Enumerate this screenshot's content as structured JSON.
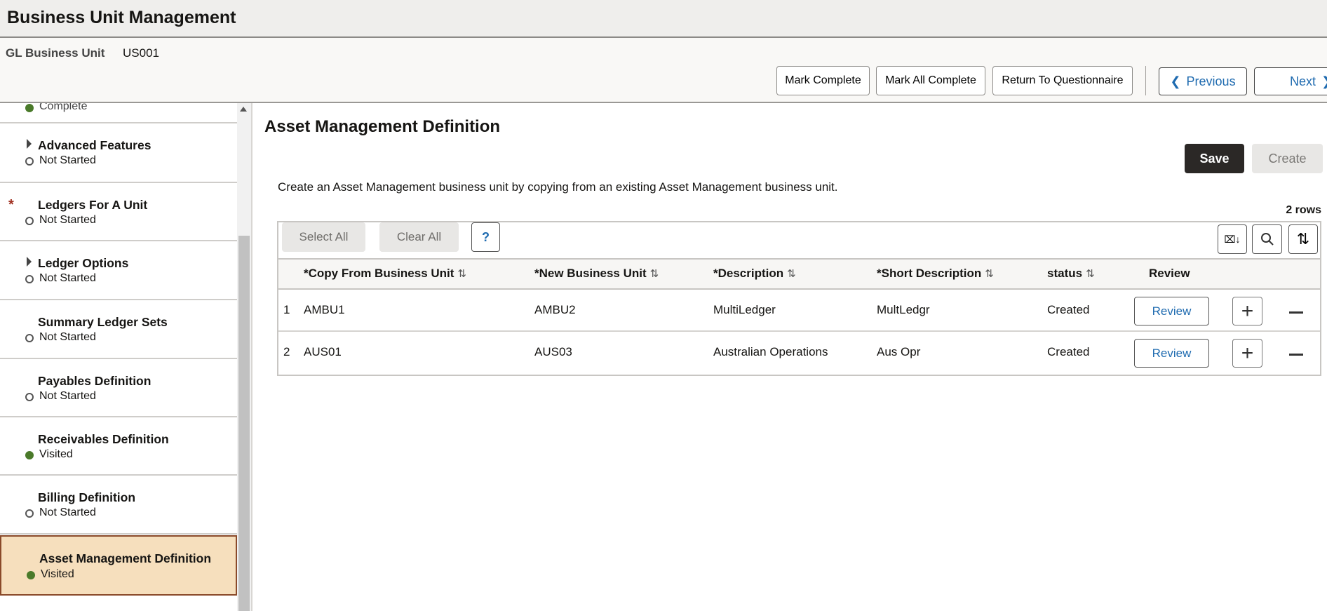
{
  "header": {
    "title": "Business Unit Management",
    "gl_label": "GL Business Unit",
    "gl_value": "US001"
  },
  "toolbar": {
    "mark_complete": "Mark Complete",
    "mark_all_complete": "Mark All Complete",
    "return": "Return To Questionnaire",
    "previous": "Previous",
    "next": "Next"
  },
  "sidebar": {
    "items": [
      {
        "title": "",
        "status": "Complete"
      },
      {
        "title": "Advanced Features",
        "status": "Not Started"
      },
      {
        "title": "Ledgers For A Unit",
        "status": "Not Started",
        "required": "*"
      },
      {
        "title": "Ledger Options",
        "status": "Not Started"
      },
      {
        "title": "Summary Ledger Sets",
        "status": "Not Started"
      },
      {
        "title": "Payables Definition",
        "status": "Not Started"
      },
      {
        "title": "Receivables Definition",
        "status": "Visited"
      },
      {
        "title": "Billing Definition",
        "status": "Not Started"
      },
      {
        "title": "Asset Management Definition",
        "status": "Visited"
      }
    ]
  },
  "main": {
    "heading": "Asset Management Definition",
    "save": "Save",
    "create": "Create",
    "description": "Create an Asset Management business unit by copying from an existing Asset Management business unit.",
    "row_count": "2 rows",
    "select_all": "Select All",
    "clear_all": "Clear All",
    "help": "?",
    "columns": [
      "*Copy From Business Unit",
      "*New Business Unit",
      "*Description",
      "*Short Description",
      "status",
      "Review"
    ],
    "sort_glyph": "⇅",
    "rows": [
      {
        "n": "1",
        "copy": "AMBU1",
        "new": "AMBU2",
        "desc": "MultiLedger",
        "short": "MultLedgr",
        "status": "Created",
        "review": "Review"
      },
      {
        "n": "2",
        "copy": "AUS01",
        "new": "AUS03",
        "desc": "Australian Operations",
        "short": "Aus Opr",
        "status": "Created",
        "review": "Review"
      }
    ]
  },
  "colors": {
    "accent": "#1f6bb0",
    "selected": "#f6dfbd",
    "visited": "#4a7a2a",
    "required": "#a03020"
  }
}
